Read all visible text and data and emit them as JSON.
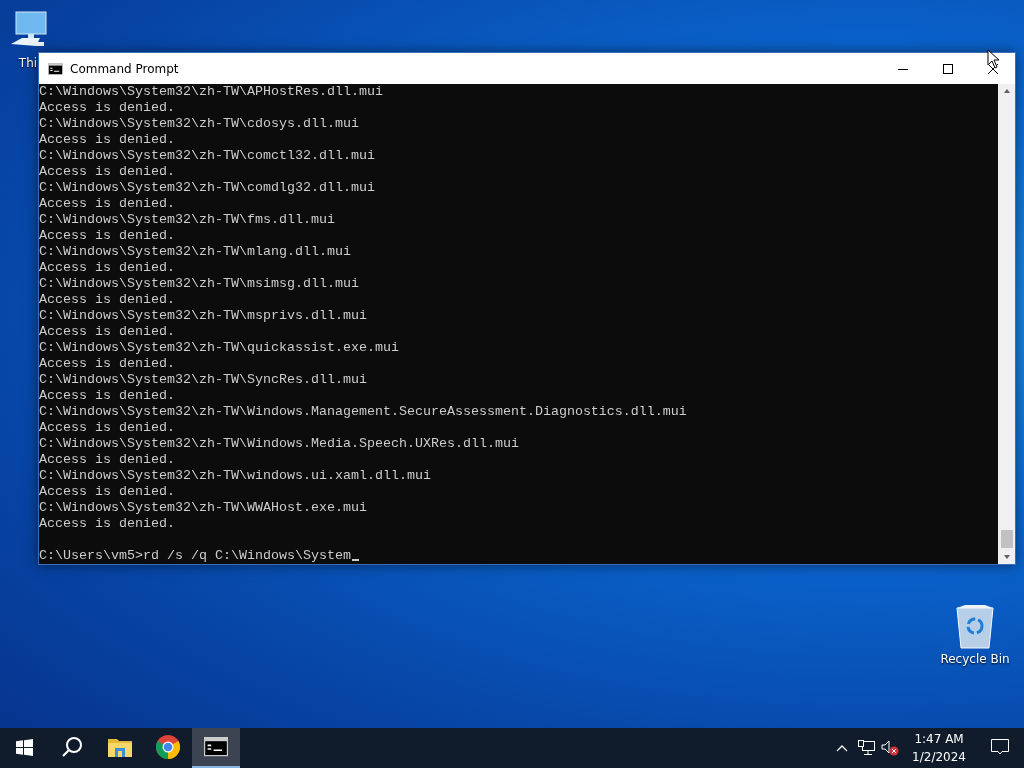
{
  "desktop_icons": [
    {
      "kind": "computer",
      "label": "Thi"
    },
    {
      "kind": "recycle",
      "label": "Recycle Bin"
    }
  ],
  "window": {
    "title": "Command Prompt",
    "lines": [
      "C:\\Windows\\System32\\zh-TW\\APHostRes.dll.mui",
      "Access is denied.",
      "C:\\Windows\\System32\\zh-TW\\cdosys.dll.mui",
      "Access is denied.",
      "C:\\Windows\\System32\\zh-TW\\comctl32.dll.mui",
      "Access is denied.",
      "C:\\Windows\\System32\\zh-TW\\comdlg32.dll.mui",
      "Access is denied.",
      "C:\\Windows\\System32\\zh-TW\\fms.dll.mui",
      "Access is denied.",
      "C:\\Windows\\System32\\zh-TW\\mlang.dll.mui",
      "Access is denied.",
      "C:\\Windows\\System32\\zh-TW\\msimsg.dll.mui",
      "Access is denied.",
      "C:\\Windows\\System32\\zh-TW\\msprivs.dll.mui",
      "Access is denied.",
      "C:\\Windows\\System32\\zh-TW\\quickassist.exe.mui",
      "Access is denied.",
      "C:\\Windows\\System32\\zh-TW\\SyncRes.dll.mui",
      "Access is denied.",
      "C:\\Windows\\System32\\zh-TW\\Windows.Management.SecureAssessment.Diagnostics.dll.mui",
      "Access is denied.",
      "C:\\Windows\\System32\\zh-TW\\Windows.Media.Speech.UXRes.dll.mui",
      "Access is denied.",
      "C:\\Windows\\System32\\zh-TW\\windows.ui.xaml.dll.mui",
      "Access is denied.",
      "C:\\Windows\\System32\\zh-TW\\WWAHost.exe.mui",
      "Access is denied."
    ],
    "prompt": "C:\\Users\\vm5>rd /s /q C:\\Windows\\System"
  },
  "taskbar": {
    "items": [
      {
        "kind": "start",
        "active": false
      },
      {
        "kind": "search",
        "active": false
      },
      {
        "kind": "explorer",
        "active": false
      },
      {
        "kind": "chrome",
        "active": false
      },
      {
        "kind": "terminal",
        "active": true
      }
    ],
    "tray": [
      {
        "kind": "chevron"
      },
      {
        "kind": "network"
      },
      {
        "kind": "volume-muted"
      }
    ],
    "clock": {
      "time": "1:47 AM",
      "date": "1/2/2024"
    }
  }
}
